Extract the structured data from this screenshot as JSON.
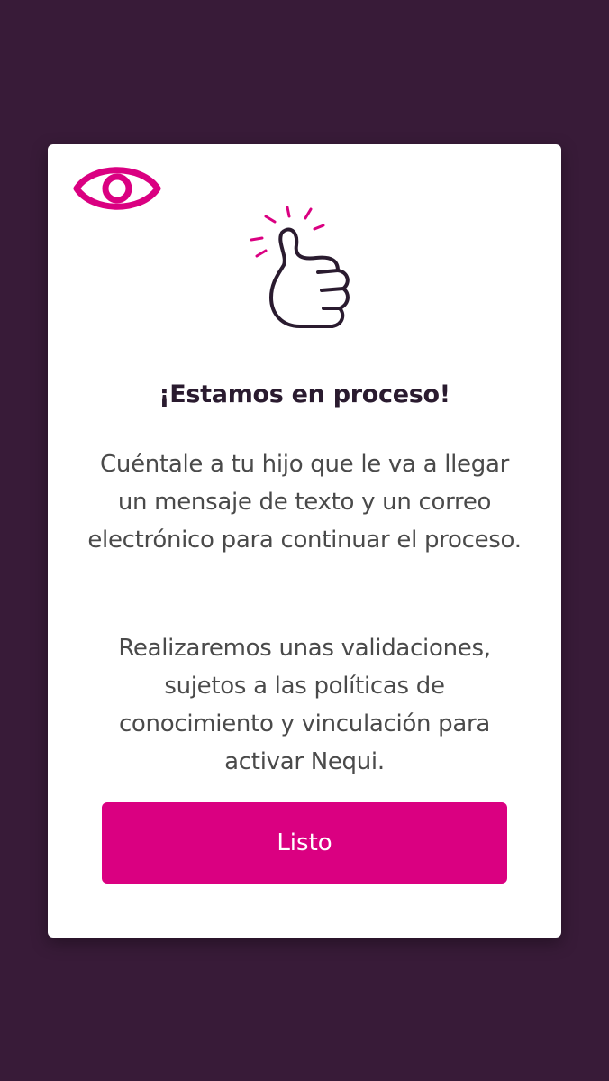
{
  "modal": {
    "title": "¡Estamos en proceso!",
    "paragraph1": "Cuéntale a tu hijo que le va a llegar un mensaje de texto y un correo electrónico para continuar el proceso.",
    "paragraph2": "Realizaremos unas validaciones, sujetos a las políticas de conocimiento y vinculación para activar Nequi.",
    "button_label": "Listo",
    "icons": {
      "top_left": "eye-icon",
      "illustration": "thumbs-up-icon"
    }
  },
  "colors": {
    "background": "#381b38",
    "accent": "#da0081",
    "title": "#2a1b2f",
    "text": "#4a4a4a"
  }
}
